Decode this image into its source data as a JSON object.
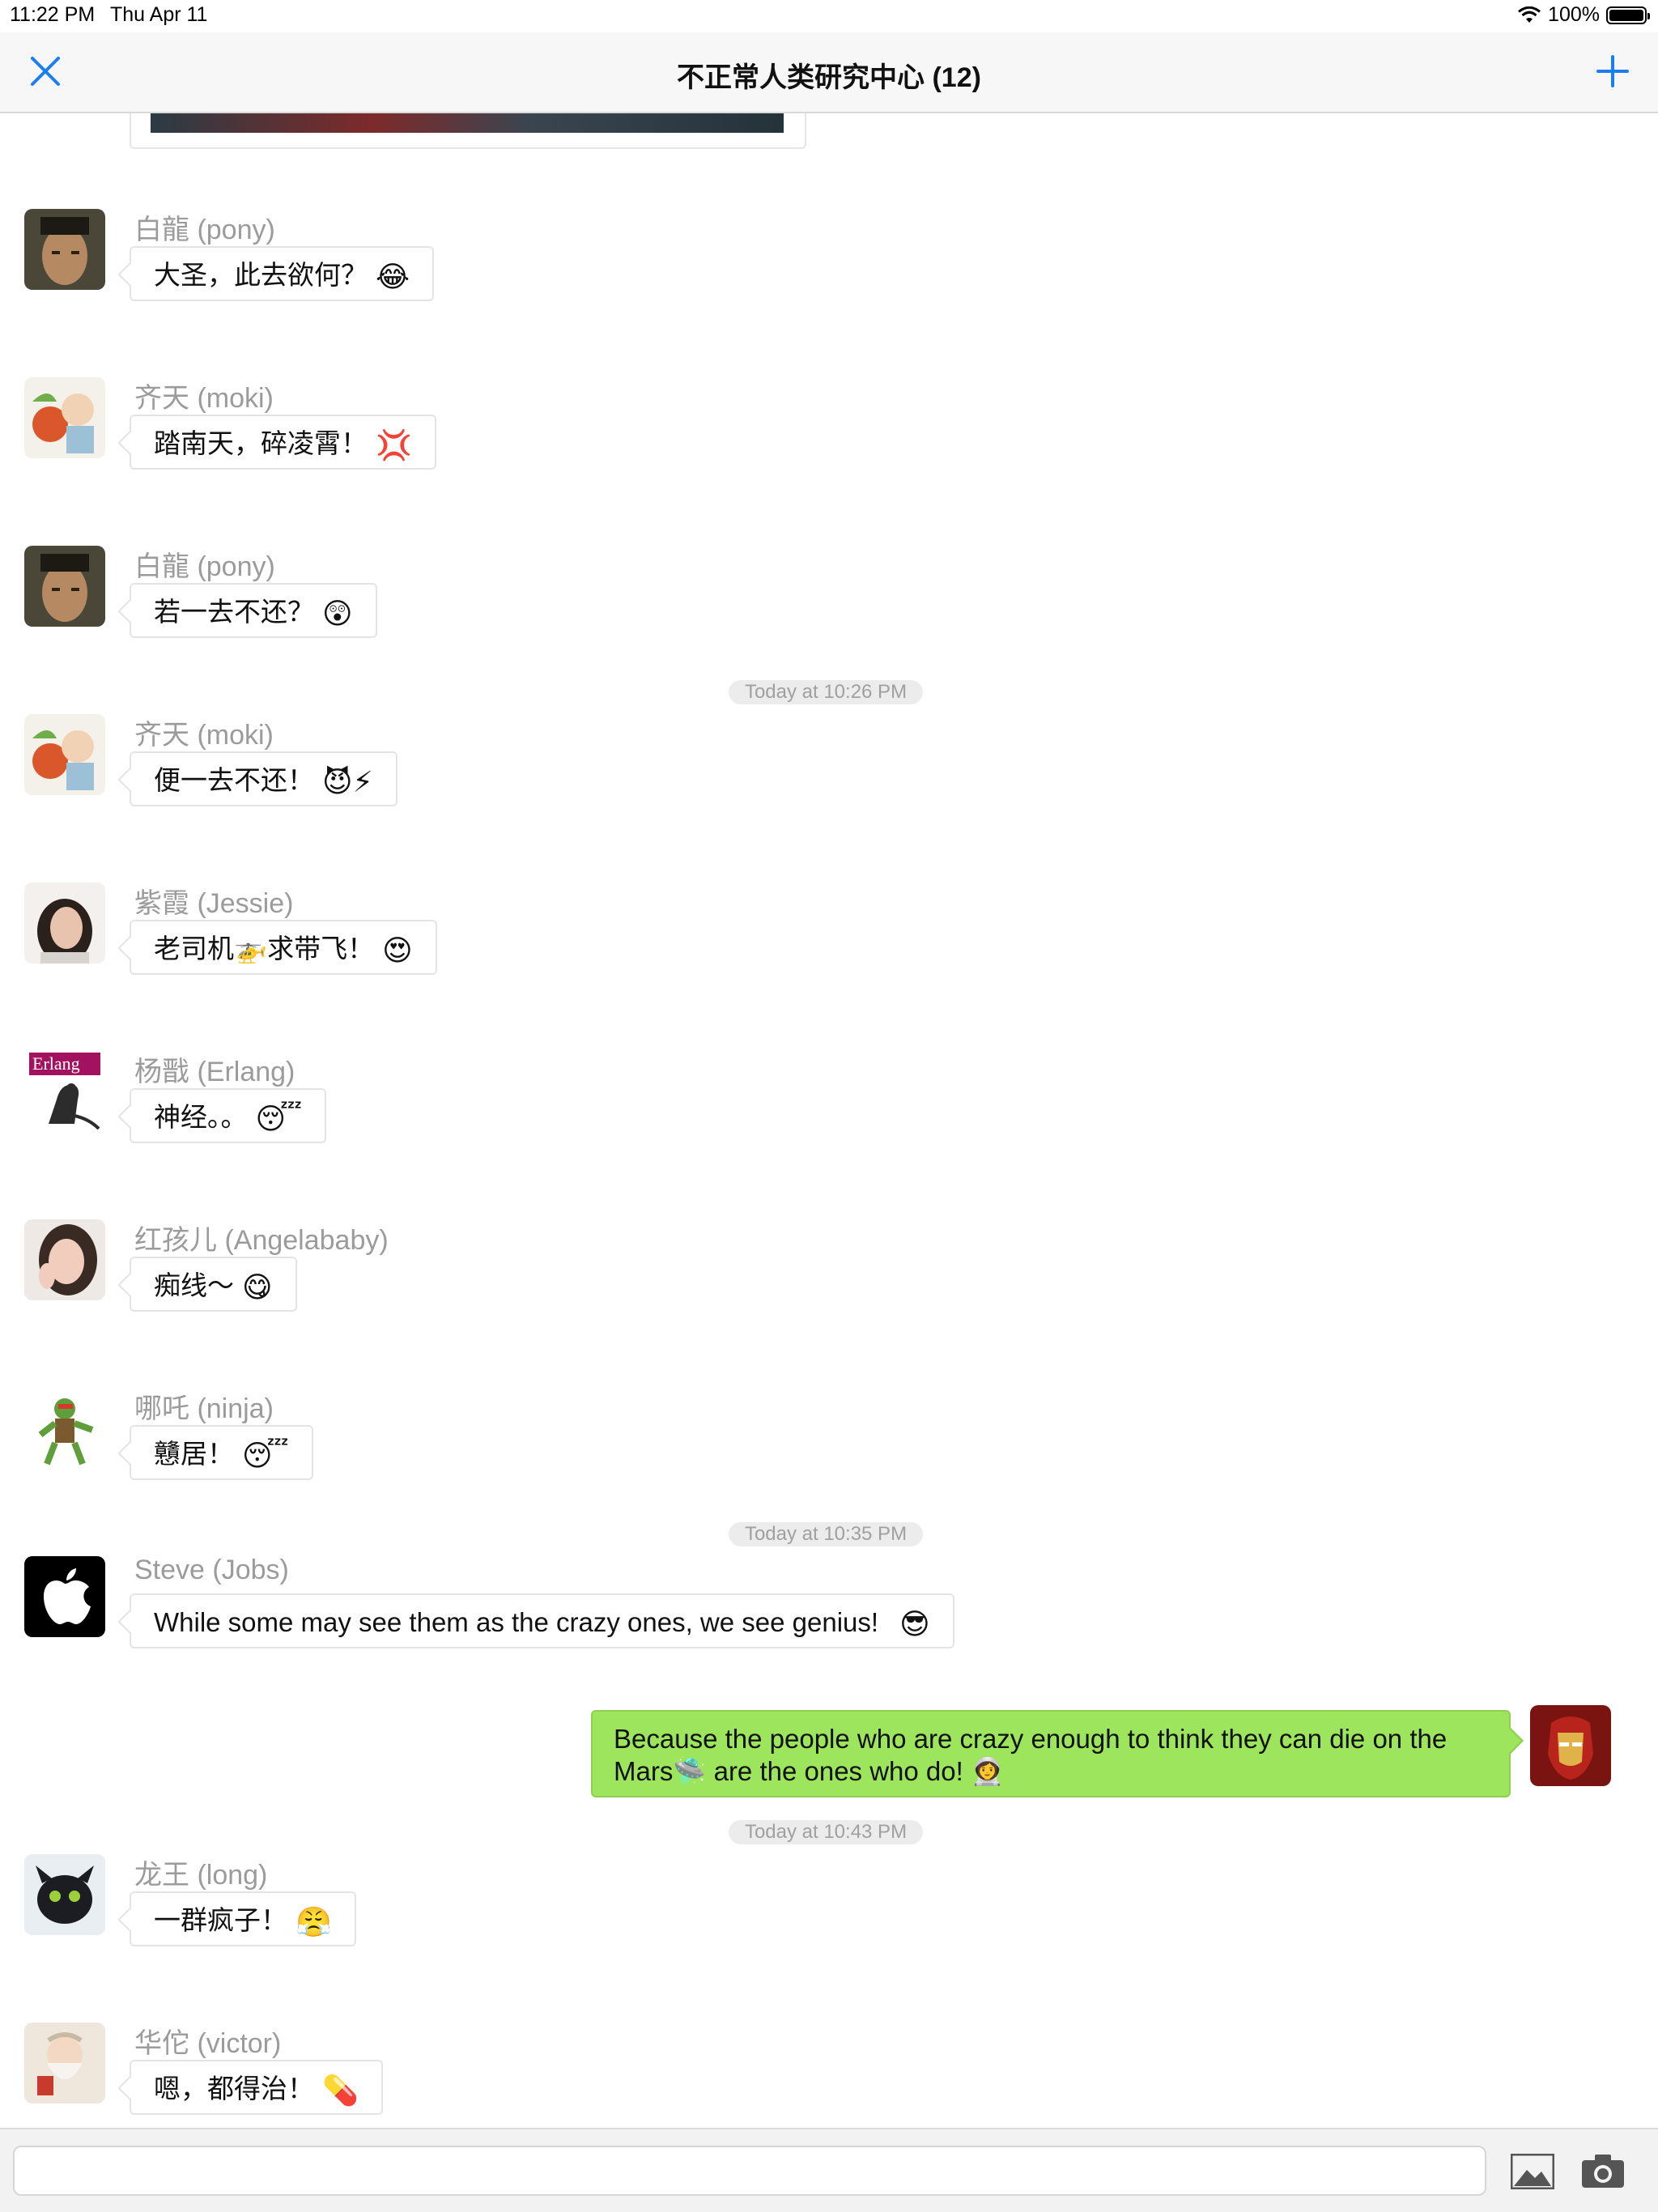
{
  "status_bar": {
    "time": "11:22 PM",
    "date": "Thu Apr 11",
    "battery": "100%"
  },
  "nav": {
    "title": "不正常人类研究中心 (12)",
    "close_icon": "close-icon",
    "add_icon": "plus-icon"
  },
  "colors": {
    "accent": "#1a7df0",
    "outgoing_bubble": "#9ce55c",
    "sender_text": "#9b9b9b"
  },
  "messages": [
    {
      "sender": "白龍 (pony)",
      "text": "大圣，此去欲何？",
      "emoji": "😂"
    },
    {
      "sender": "齐天 (moki)",
      "text": "踏南天，碎凌霄！",
      "emoji": "💢"
    },
    {
      "sender": "白龍 (pony)",
      "text": "若一去不还？",
      "emoji": "😲"
    },
    {
      "sender": "齐天 (moki)",
      "text": "便一去不还！",
      "emoji": "😈⚡"
    },
    {
      "sender": "紫霞 (Jessie)",
      "text": "老司机🚁求带飞！",
      "emoji": "😍"
    },
    {
      "sender": "杨戬 (Erlang)",
      "text": "神经。。",
      "emoji": "😴"
    },
    {
      "sender": "红孩儿 (Angelababy)",
      "text": "痴线～",
      "emoji": "😋"
    },
    {
      "sender": "哪吒 (ninja)",
      "text": "戇居！",
      "emoji": "😴"
    },
    {
      "sender": "Steve (Jobs)",
      "text": "While some may see them as the crazy ones, we see genius!",
      "emoji": "😎"
    },
    {
      "sender": "龙王 (long)",
      "text": "一群疯子！",
      "emoji": "😤"
    },
    {
      "sender": "华佗 (victor)",
      "text": "嗯，都得治！",
      "emoji": "💊"
    }
  ],
  "timestamps": [
    "Today at 10:26 PM",
    "Today at 10:35 PM",
    "Today at 10:43 PM"
  ],
  "outgoing": {
    "text": "Because the people who are crazy enough to think they can die on the Mars🛸 are the ones who do! 👩‍🚀"
  },
  "avatars": {
    "erlang_label": "Erlang"
  },
  "input": {
    "placeholder": "",
    "photo_icon": "image-icon",
    "camera_icon": "camera-icon"
  }
}
